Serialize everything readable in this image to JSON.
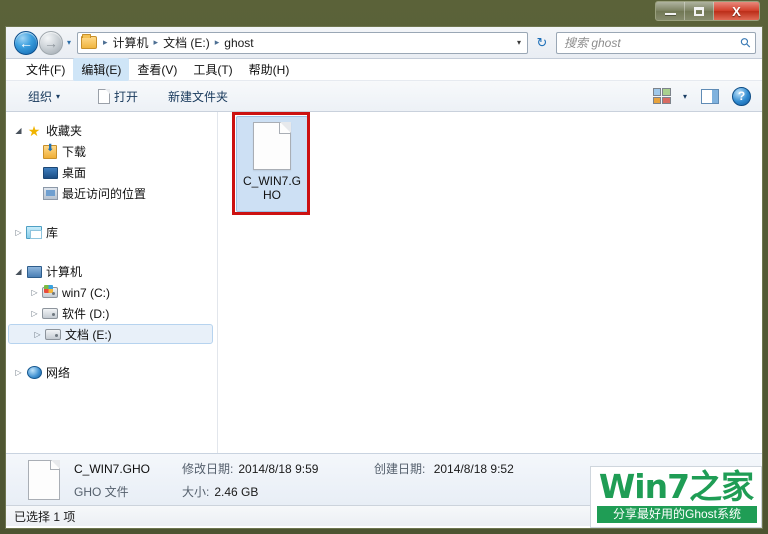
{
  "window": {
    "buttons": {
      "minimize": "–",
      "maximize": "□",
      "close": "X"
    }
  },
  "addressbar": {
    "back_glyph": "←",
    "forward_glyph": "→",
    "history_glyph": "▾",
    "dropdown_glyph": "▾",
    "refresh_glyph": "↻",
    "separator": "▸",
    "crumbs": [
      "计算机",
      "文档 (E:)",
      "ghost"
    ]
  },
  "search": {
    "placeholder": "搜索 ghost",
    "icon_glyph": "⚲"
  },
  "menubar": {
    "items": [
      {
        "label": "文件(F)",
        "active": false
      },
      {
        "label": "编辑(E)",
        "active": true
      },
      {
        "label": "查看(V)",
        "active": false
      },
      {
        "label": "工具(T)",
        "active": false
      },
      {
        "label": "帮助(H)",
        "active": false
      }
    ]
  },
  "toolbar": {
    "organize_label": "组织",
    "organize_caret": "▾",
    "open_label": "打开",
    "newfolder_label": "新建文件夹",
    "view_caret": "▾",
    "help_glyph": "?"
  },
  "sidebar": {
    "items": [
      {
        "label": "收藏夹",
        "level": 1,
        "twisty": "◢",
        "icon": "star-icon",
        "selected": false
      },
      {
        "label": "下载",
        "level": 2,
        "twisty": "",
        "icon": "downloads-icon",
        "selected": false
      },
      {
        "label": "桌面",
        "level": 2,
        "twisty": "",
        "icon": "desktop-icon",
        "selected": false
      },
      {
        "label": "最近访问的位置",
        "level": 2,
        "twisty": "",
        "icon": "recent-places-icon",
        "selected": false
      },
      {
        "label": "库",
        "level": 1,
        "twisty": "▷",
        "icon": "library-icon",
        "selected": false
      },
      {
        "label": "计算机",
        "level": 1,
        "twisty": "◢",
        "icon": "computer-icon",
        "selected": false
      },
      {
        "label": "win7 (C:)",
        "level": 2,
        "twisty": "▷",
        "icon": "windows-drive-icon",
        "selected": false
      },
      {
        "label": "软件 (D:)",
        "level": 2,
        "twisty": "▷",
        "icon": "drive-icon",
        "selected": false
      },
      {
        "label": "文档 (E:)",
        "level": 2,
        "twisty": "▷",
        "icon": "drive-icon",
        "selected": true
      },
      {
        "label": "网络",
        "level": 1,
        "twisty": "▷",
        "icon": "network-icon",
        "selected": false
      }
    ]
  },
  "filepane": {
    "file": {
      "name": "C_WIN7.GHO",
      "selected": true,
      "highlighted": true
    }
  },
  "details": {
    "name": "C_WIN7.GHO",
    "modified_label": "修改日期:",
    "modified_value": "2014/8/18 9:59",
    "created_label": "创建日期:",
    "created_value": "2014/8/18 9:52",
    "type": "GHO 文件",
    "size_label": "大小:",
    "size_value": "2.46 GB"
  },
  "statusbar": {
    "text": "已选择 1 项"
  },
  "watermark": {
    "main": "Win7之家",
    "sub": "分享最好用的Ghost系统",
    "color": "#1f9d55"
  }
}
